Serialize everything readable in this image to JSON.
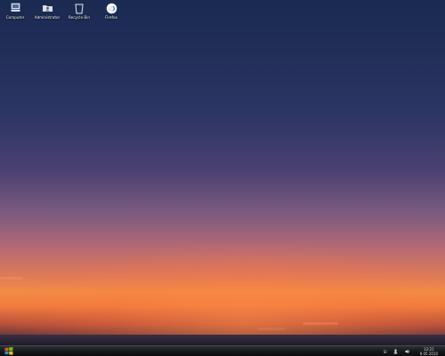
{
  "desktop": {
    "icons": [
      {
        "label": "Computer",
        "icon": "computer-icon"
      },
      {
        "label": "Administrator",
        "icon": "user-folder-icon"
      },
      {
        "label": "Recycle Bin",
        "icon": "recycle-bin-icon"
      },
      {
        "label": "Firefox",
        "icon": "firefox-icon"
      }
    ]
  },
  "taskbar": {
    "start_icon": "windows-logo-icon",
    "tray": {
      "language": "SI",
      "icons": [
        "network-icon",
        "volume-icon"
      ],
      "clock_time": "12:21",
      "clock_date": "9.05.2010"
    }
  },
  "colors": {
    "sky_top": "#1a2a52",
    "sunset": "#f28b46",
    "taskbar": "#141719"
  }
}
